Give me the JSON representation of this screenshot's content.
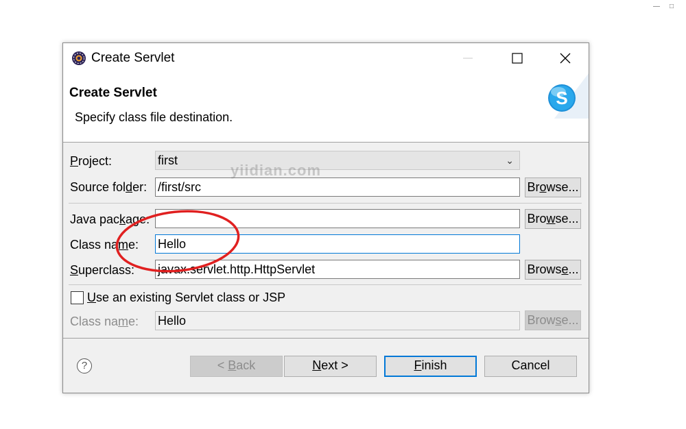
{
  "dialog": {
    "title": "Create Servlet",
    "header_title": "Create Servlet",
    "header_desc": "Specify class file destination.",
    "colors": {
      "accent": "#0078d7",
      "annotation": "#e02020",
      "logo": "#1e90d8"
    }
  },
  "form": {
    "project": {
      "label_pre": "",
      "label_key": "P",
      "label_post": "roject:",
      "value": "first"
    },
    "source_folder": {
      "label_pre": "Source fol",
      "label_key": "d",
      "label_post": "er:",
      "value": "/first/src",
      "browse": {
        "pre": "Br",
        "key": "o",
        "post": "wse..."
      }
    },
    "java_package": {
      "label_pre": "Java pac",
      "label_key": "k",
      "label_post": "age:",
      "value": "",
      "browse": {
        "pre": "Bro",
        "key": "w",
        "post": "se..."
      }
    },
    "class_name": {
      "label_pre": "Class na",
      "label_key": "m",
      "label_post": "e:",
      "value": "Hello"
    },
    "superclass": {
      "label_pre": "",
      "label_key": "S",
      "label_post": "uperclass:",
      "value": "javax.servlet.http.HttpServlet",
      "browse": {
        "pre": "Brows",
        "key": "e",
        "post": "..."
      }
    },
    "existing": {
      "checkbox_pre": "",
      "checkbox_key": "U",
      "checkbox_post": "se an existing Servlet class or JSP",
      "checked": false
    },
    "existing_class_name": {
      "label_pre": "Class na",
      "label_key": "m",
      "label_post": "e:",
      "value": "Hello",
      "browse": {
        "pre": "Brow",
        "key": "s",
        "post": "e..."
      }
    }
  },
  "buttons": {
    "back": {
      "pre": "< ",
      "key": "B",
      "post": "ack"
    },
    "next": {
      "pre": "",
      "key": "N",
      "post": "ext >"
    },
    "finish": {
      "pre": "",
      "key": "F",
      "post": "inish"
    },
    "cancel": "Cancel",
    "help": "?"
  },
  "watermark": "yiidian.com",
  "icons": [
    "eclipse-app-icon",
    "minimize-icon",
    "maximize-icon",
    "close-icon",
    "servlet-logo-icon",
    "help-icon",
    "chevron-down-icon"
  ]
}
